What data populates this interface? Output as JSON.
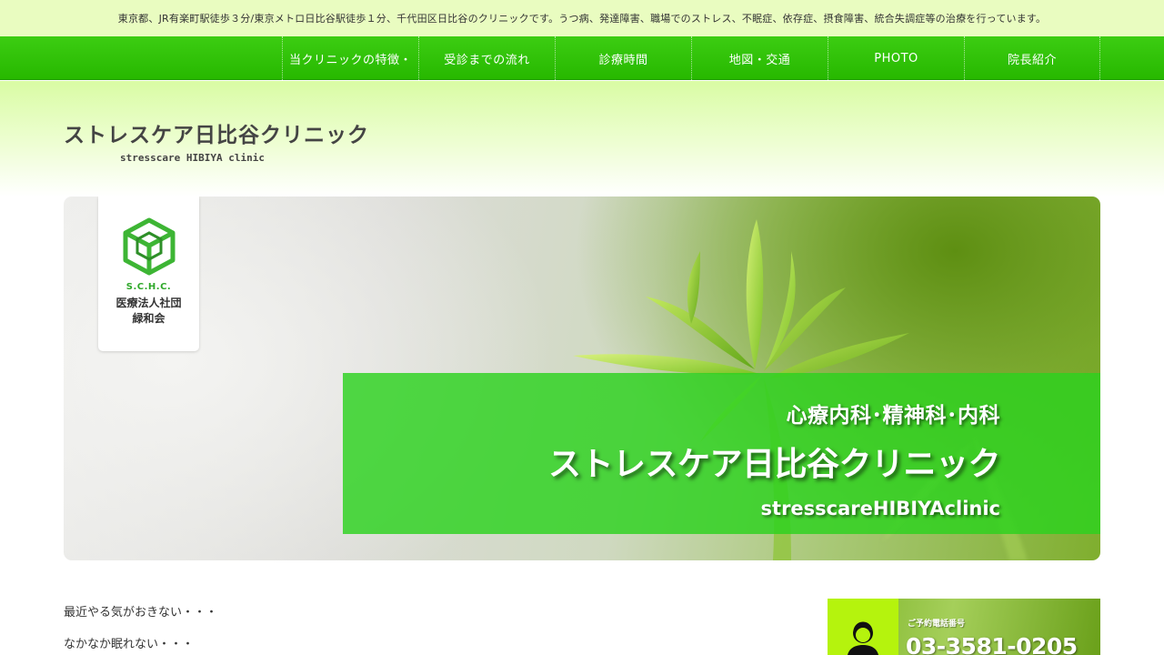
{
  "topbar": {
    "text": "東京都、JR有楽町駅徒歩３分/東京メトロ日比谷駅徒歩１分、千代田区日比谷のクリニックです。うつ病、発達障害、職場でのストレス、不眠症、依存症、摂食障害、統合失調症等の治療を行っています。"
  },
  "nav": {
    "items": [
      {
        "label": "当クリニックの特徴・"
      },
      {
        "label": "受診までの流れ"
      },
      {
        "label": "診療時間"
      },
      {
        "label": "地図・交通"
      },
      {
        "label": "PHOTO"
      },
      {
        "label": "院長紹介"
      }
    ]
  },
  "logo": {
    "main": "ストレスケア日比谷クリニック",
    "sub": "stresscare HIBIYA clinic"
  },
  "org": {
    "abbr": "S.C.H.C.",
    "name_line1": "医療法人社団",
    "name_line2": "緑和会"
  },
  "hero": {
    "dept": "心療内科･精神科･内科",
    "name": "ストレスケア日比谷クリニック",
    "roman": "stresscareHIBIYAclinic"
  },
  "intro": {
    "lines": [
      "最近やる気がおきない・・・",
      "なかなか眠れない・・・"
    ]
  },
  "phone": {
    "label": "ご予約電話番号",
    "number": "03-3581-0205",
    "icon": "receptionist-icon"
  },
  "colors": {
    "nav_green": "#2cc408",
    "topbar_bg": "#e9fcc0",
    "panel_green": "#2cd21e",
    "logo_green": "#2fa82a",
    "phone_icon_bg": "#b5f30d"
  }
}
